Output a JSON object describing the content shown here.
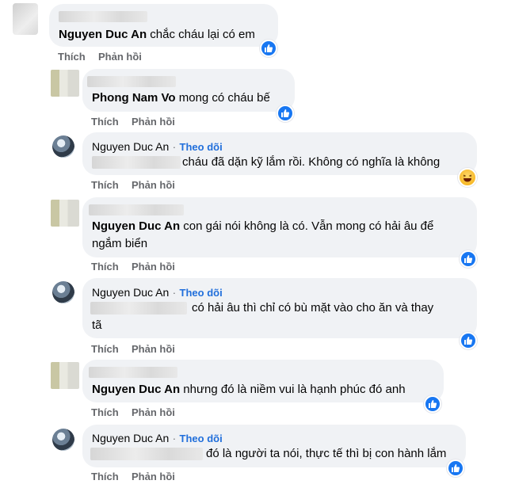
{
  "actions": {
    "like": "Thích",
    "reply": "Phản hồi"
  },
  "follow_label": "Theo dõi",
  "dot": "·",
  "colors": {
    "bubble": "#f0f2f5",
    "link": "#216fdb",
    "muted": "#65676b",
    "like_blue": "#1877f2"
  },
  "comments": [
    {
      "name": "Nguyen Duc An",
      "text": "chắc cháu lại có em",
      "reaction": "like-icon"
    },
    {
      "name": "Phong Nam Vo",
      "text": "mong có cháu bế",
      "reaction": "like-icon"
    },
    {
      "name": "Nguyen Duc An",
      "text": "cháu đã dặn kỹ lắm rồi. Không có nghĩa là không",
      "reaction": "haha-icon"
    },
    {
      "name": "Nguyen Duc An",
      "text_line1": "con gái nói không là có. Vẫn mong có hải âu để",
      "text_line2": "ngắm biển",
      "reaction": "like-icon"
    },
    {
      "name": "Nguyen Duc An",
      "text_line1": "có hải âu thì chỉ có bù mặt vào cho ăn và thay",
      "text_line2": "tã",
      "reaction": "like-icon"
    },
    {
      "name": "Nguyen Duc An",
      "text": "nhưng đó là niềm vui là hạnh phúc đó anh",
      "reaction": "like-icon"
    },
    {
      "name": "Nguyen Duc An",
      "text": "đó là người ta nói, thực tế thì bị con hành lắm",
      "reaction": "like-icon"
    }
  ]
}
